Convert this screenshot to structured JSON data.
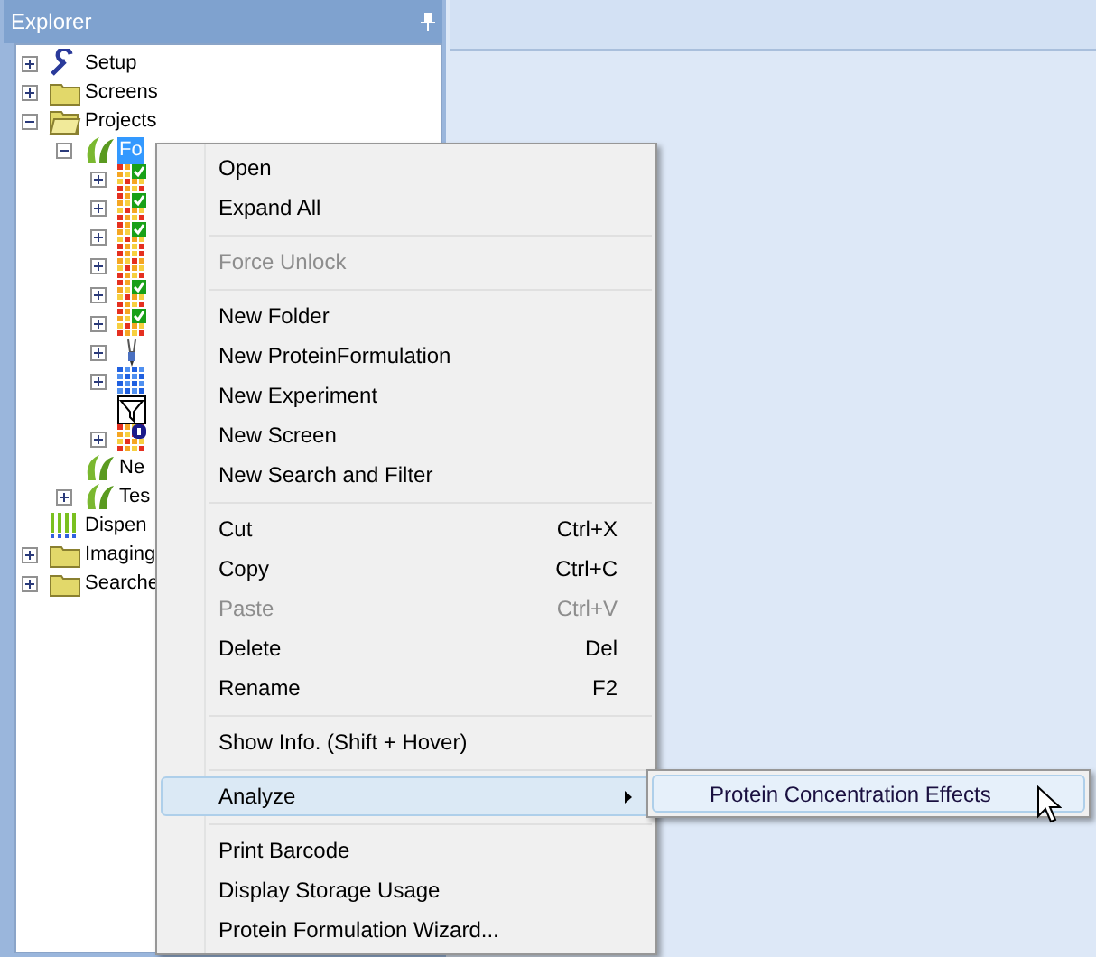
{
  "explorer": {
    "title": "Explorer",
    "tree": [
      {
        "label": "Setup",
        "kind": "wrench",
        "expandable": true,
        "expanded": false,
        "selected": false
      },
      {
        "label": "Screens",
        "kind": "folder",
        "expandable": true,
        "expanded": false,
        "selected": false
      },
      {
        "label": "Projects",
        "kind": "folder",
        "expandable": true,
        "expanded": true,
        "selected": false,
        "children": [
          {
            "label": "Fo",
            "kind": "plant",
            "expandable": true,
            "expanded": true,
            "selected": true,
            "children": [
              {
                "kind": "grid-check",
                "expandable": true,
                "expanded": false,
                "selected": false
              },
              {
                "kind": "grid-check",
                "expandable": true,
                "expanded": false,
                "selected": false
              },
              {
                "kind": "grid-check",
                "expandable": true,
                "expanded": false,
                "selected": false
              },
              {
                "kind": "grid",
                "expandable": true,
                "expanded": false,
                "selected": false
              },
              {
                "kind": "grid-check",
                "expandable": true,
                "expanded": false,
                "selected": false
              },
              {
                "kind": "grid-check",
                "expandable": true,
                "expanded": false,
                "selected": false
              },
              {
                "kind": "pipette",
                "expandable": true,
                "expanded": false,
                "selected": false
              },
              {
                "kind": "blue-grid",
                "expandable": true,
                "expanded": false,
                "selected": false
              },
              {
                "kind": "filter",
                "expandable": false,
                "selected": false
              },
              {
                "kind": "grid-info",
                "expandable": true,
                "expanded": false,
                "selected": false
              }
            ]
          },
          {
            "label": "Ne",
            "kind": "plant",
            "expandable": false,
            "selected": false
          },
          {
            "label": "Tes",
            "kind": "plant",
            "expandable": true,
            "expanded": false,
            "selected": false
          }
        ]
      },
      {
        "label": "Dispen",
        "kind": "dispenser",
        "expandable": false,
        "selected": false
      },
      {
        "label": "Imaging",
        "kind": "folder",
        "expandable": true,
        "expanded": false,
        "selected": false
      },
      {
        "label": "Searche",
        "kind": "folder",
        "expandable": true,
        "expanded": false,
        "selected": false
      }
    ]
  },
  "context_menu": [
    {
      "kind": "item",
      "label": "Open",
      "disabled": false,
      "selected": false
    },
    {
      "kind": "item",
      "label": "Expand All",
      "disabled": false,
      "selected": false
    },
    {
      "kind": "separator"
    },
    {
      "kind": "item",
      "label": "Force Unlock",
      "disabled": true,
      "selected": false
    },
    {
      "kind": "separator"
    },
    {
      "kind": "item",
      "label": "New Folder",
      "disabled": false,
      "selected": false
    },
    {
      "kind": "item",
      "label": "New ProteinFormulation",
      "disabled": false,
      "selected": false
    },
    {
      "kind": "item",
      "label": "New Experiment",
      "disabled": false,
      "selected": false
    },
    {
      "kind": "item",
      "label": "New Screen",
      "disabled": false,
      "selected": false
    },
    {
      "kind": "item",
      "label": "New Search and Filter",
      "disabled": false,
      "selected": false
    },
    {
      "kind": "separator"
    },
    {
      "kind": "item",
      "label": "Cut",
      "shortcut": "Ctrl+X",
      "disabled": false,
      "selected": false
    },
    {
      "kind": "item",
      "label": "Copy",
      "shortcut": "Ctrl+C",
      "disabled": false,
      "selected": false
    },
    {
      "kind": "item",
      "label": "Paste",
      "shortcut": "Ctrl+V",
      "disabled": true,
      "selected": false
    },
    {
      "kind": "item",
      "label": "Delete",
      "shortcut": "Del",
      "disabled": false,
      "selected": false
    },
    {
      "kind": "item",
      "label": "Rename",
      "shortcut": "F2",
      "disabled": false,
      "selected": false
    },
    {
      "kind": "separator"
    },
    {
      "kind": "item",
      "label": "Show Info. (Shift + Hover)",
      "disabled": false,
      "selected": false
    },
    {
      "kind": "separator"
    },
    {
      "kind": "submenu",
      "label": "Analyze",
      "disabled": false,
      "selected": true
    },
    {
      "kind": "separator"
    },
    {
      "kind": "item",
      "label": "Print Barcode",
      "disabled": false,
      "selected": false
    },
    {
      "kind": "item",
      "label": "Display Storage Usage",
      "disabled": false,
      "selected": false
    },
    {
      "kind": "item",
      "label": "Protein Formulation Wizard...",
      "disabled": false,
      "selected": false
    }
  ],
  "submenu": [
    {
      "label": "Protein Concentration Effects",
      "selected": true
    }
  ]
}
